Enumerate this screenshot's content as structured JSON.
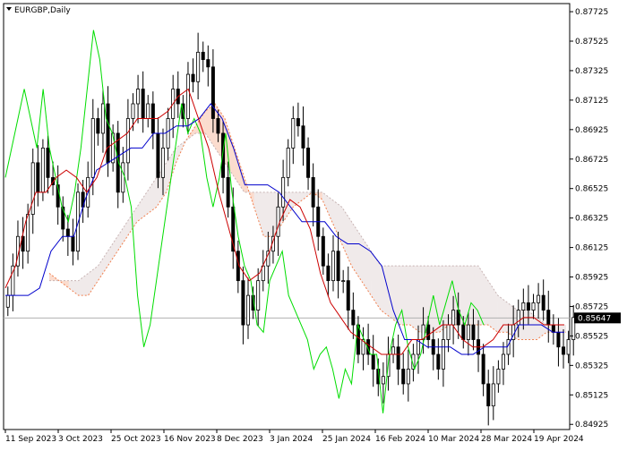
{
  "header": {
    "symbol_label": "EURGBP,Daily",
    "dropdown_icon": "triangle-down-icon"
  },
  "price_marker": {
    "value": "0.85647"
  },
  "colors": {
    "background": "#ffffff",
    "axis": "#000000",
    "candle_up": "#ffffff",
    "candle_down": "#000000",
    "tenkan": "#cc0000",
    "kijun": "#0000cc",
    "chikou": "#00dd00",
    "span_a": "#f08050",
    "span_b": "#c8b4b4",
    "price_line": "#b0b0b0"
  },
  "chart_data": {
    "type": "candlestick",
    "indicator": "Ichimoku Kinko Hyo",
    "ylim": [
      0.8489,
      0.8778
    ],
    "y_ticks": [
      "0.87725",
      "0.87525",
      "0.87325",
      "0.87125",
      "0.86925",
      "0.86725",
      "0.86525",
      "0.86325",
      "0.86125",
      "0.85925",
      "0.85725",
      "0.85525",
      "0.85325",
      "0.85125",
      "0.84925"
    ],
    "x_ticks": [
      "11 Sep 2023",
      "3 Oct 2023",
      "25 Oct 2023",
      "16 Nov 2023",
      "8 Dec 2023",
      "3 Jan 2024",
      "25 Jan 2024",
      "16 Feb 2024",
      "10 Mar 2024",
      "28 Mar 2024",
      "19 Apr 2024"
    ],
    "last_price": 0.85647,
    "series": [
      {
        "name": "close",
        "values": [
          0.858,
          0.86,
          0.862,
          0.861,
          0.8635,
          0.867,
          0.865,
          0.868,
          0.866,
          0.8655,
          0.864,
          0.8625,
          0.862,
          0.861,
          0.865,
          0.864,
          0.866,
          0.87,
          0.869,
          0.871,
          0.867,
          0.869,
          0.865,
          0.867,
          0.87,
          0.871,
          0.872,
          0.87,
          0.871,
          0.869,
          0.866,
          0.868,
          0.87,
          0.872,
          0.871,
          0.87,
          0.873,
          0.8725,
          0.8745,
          0.874,
          0.8735,
          0.87,
          0.869,
          0.866,
          0.864,
          0.861,
          0.859,
          0.856,
          0.858,
          0.857,
          0.859,
          0.86,
          0.861,
          0.862,
          0.864,
          0.866,
          0.868,
          0.87,
          0.8695,
          0.868,
          0.866,
          0.864,
          0.862,
          0.86,
          0.859,
          0.861,
          0.859,
          0.859,
          0.857,
          0.856,
          0.854,
          0.855,
          0.854,
          0.853,
          0.852,
          0.8525,
          0.854,
          0.8545,
          0.853,
          0.852,
          0.853,
          0.854,
          0.855,
          0.856,
          0.855,
          0.854,
          0.853,
          0.855,
          0.856,
          0.857,
          0.856,
          0.855,
          0.856,
          0.855,
          0.854,
          0.852,
          0.8505,
          0.852,
          0.853,
          0.854,
          0.855,
          0.856,
          0.857,
          0.8575,
          0.857,
          0.8575,
          0.858,
          0.857,
          0.856,
          0.8555,
          0.8545,
          0.854,
          0.855,
          0.8565
        ]
      }
    ],
    "ichimoku": {
      "tenkan_sen": [
        0.8585,
        0.86,
        0.863,
        0.865,
        0.865,
        0.866,
        0.8665,
        0.866,
        0.865,
        0.866,
        0.868,
        0.8685,
        0.869,
        0.87,
        0.87,
        0.87,
        0.8705,
        0.8715,
        0.872,
        0.87,
        0.868,
        0.865,
        0.8625,
        0.86,
        0.859,
        0.8595,
        0.861,
        0.863,
        0.8645,
        0.864,
        0.8625,
        0.8595,
        0.8575,
        0.8565,
        0.8555,
        0.855,
        0.8545,
        0.854,
        0.854,
        0.854,
        0.855,
        0.855,
        0.8555,
        0.856,
        0.856,
        0.855,
        0.8545,
        0.8545,
        0.855,
        0.856,
        0.856,
        0.8565,
        0.8565,
        0.856,
        0.856,
        0.856
      ],
      "kijun_sen": [
        0.858,
        0.858,
        0.858,
        0.8585,
        0.861,
        0.862,
        0.862,
        0.8645,
        0.8665,
        0.867,
        0.8675,
        0.868,
        0.868,
        0.869,
        0.869,
        0.8695,
        0.8695,
        0.87,
        0.871,
        0.87,
        0.868,
        0.8655,
        0.8655,
        0.8655,
        0.865,
        0.864,
        0.863,
        0.863,
        0.863,
        0.862,
        0.8615,
        0.8615,
        0.861,
        0.86,
        0.857,
        0.855,
        0.855,
        0.8545,
        0.8545,
        0.8545,
        0.854,
        0.854,
        0.8545,
        0.8545,
        0.8545,
        0.856,
        0.856,
        0.856,
        0.8555,
        0.8555
      ],
      "chikou_span": [
        0.866,
        0.868,
        0.87,
        0.872,
        0.87,
        0.868,
        0.872,
        0.868,
        0.866,
        0.864,
        0.863,
        0.865,
        0.868,
        0.872,
        0.876,
        0.874,
        0.87,
        0.869,
        0.867,
        0.866,
        0.864,
        0.858,
        0.8545,
        0.856,
        0.859,
        0.862,
        0.865,
        0.868,
        0.871,
        0.869,
        0.87,
        0.869,
        0.866,
        0.864,
        0.866,
        0.869,
        0.865,
        0.862,
        0.86,
        0.859,
        0.856,
        0.8555,
        0.859,
        0.86,
        0.861,
        0.858,
        0.857,
        0.856,
        0.855,
        0.853,
        0.854,
        0.8545,
        0.853,
        0.851,
        0.853,
        0.852,
        0.856,
        0.855,
        0.854,
        0.854,
        0.85,
        0.854,
        0.856,
        0.857,
        0.8545,
        0.853,
        0.854,
        0.856,
        0.858,
        0.856,
        0.8575,
        0.859,
        0.857,
        0.856,
        0.8575,
        0.857,
        0.856
      ],
      "span_a": [
        0.8595,
        0.859,
        0.8585,
        0.858,
        0.858,
        0.859,
        0.86,
        0.861,
        0.862,
        0.863,
        0.8635,
        0.864,
        0.865,
        0.867,
        0.8685,
        0.8695,
        0.8705,
        0.871,
        0.87,
        0.868,
        0.866,
        0.864,
        0.862,
        0.862,
        0.863,
        0.864,
        0.8645,
        0.865,
        0.8645,
        0.863,
        0.8615,
        0.86,
        0.859,
        0.858,
        0.857,
        0.8565,
        0.856,
        0.856,
        0.8555,
        0.8555,
        0.8555,
        0.856,
        0.856,
        0.856,
        0.856,
        0.856,
        0.8555,
        0.8555,
        0.855,
        0.855,
        0.855,
        0.8555,
        0.8555,
        0.8555
      ],
      "span_b": [
        0.859,
        0.859,
        0.859,
        0.859,
        0.8595,
        0.86,
        0.861,
        0.862,
        0.863,
        0.864,
        0.865,
        0.866,
        0.867,
        0.868,
        0.8685,
        0.869,
        0.869,
        0.868,
        0.867,
        0.866,
        0.865,
        0.865,
        0.865,
        0.865,
        0.865,
        0.865,
        0.865,
        0.865,
        0.865,
        0.8645,
        0.864,
        0.863,
        0.862,
        0.861,
        0.86,
        0.86,
        0.86,
        0.86,
        0.86,
        0.86,
        0.86,
        0.86,
        0.86,
        0.86,
        0.86,
        0.859,
        0.858,
        0.8575,
        0.857,
        0.857,
        0.8565,
        0.856,
        0.856,
        0.856
      ]
    }
  }
}
